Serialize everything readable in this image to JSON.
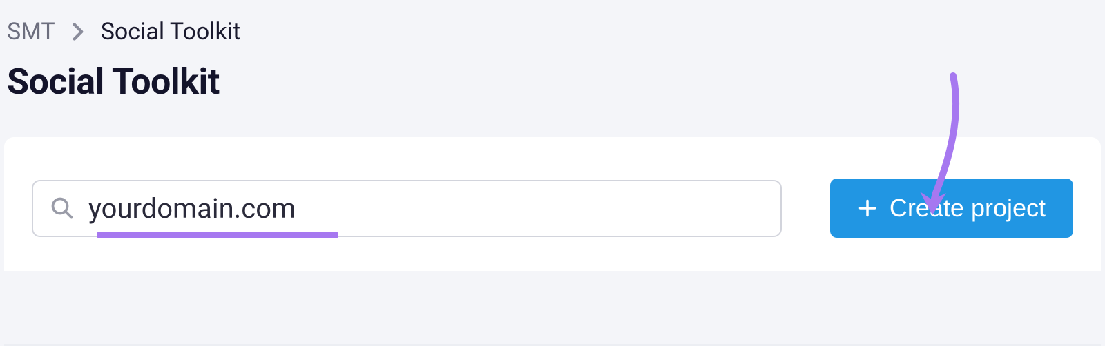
{
  "breadcrumb": {
    "root": "SMT",
    "current": "Social Toolkit"
  },
  "page": {
    "title": "Social Toolkit"
  },
  "search": {
    "value": "yourdomain.com",
    "placeholder": ""
  },
  "actions": {
    "create_project_label": "Create project"
  },
  "annotation": {
    "arrow_color": "#a678f0",
    "underline_color": "#a678f0"
  }
}
